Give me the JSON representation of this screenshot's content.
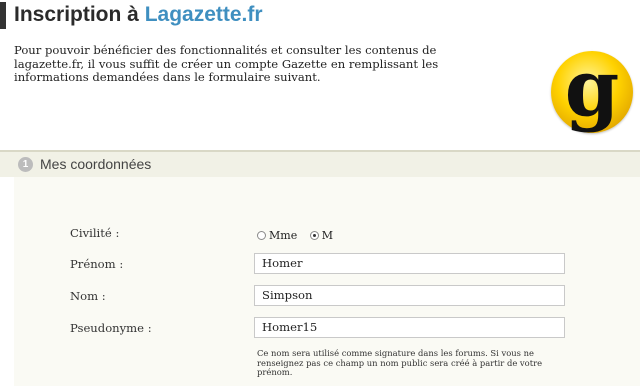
{
  "header": {
    "title_prefix": "Inscription à ",
    "title_brand": "Lagazette.fr"
  },
  "intro": {
    "text": "Pour pouvoir bénéficier des fonctionnalités et consulter les contenus de lagazette.fr, il vous suffit de créer un compte Gazette en remplissant les informations demandées dans le formulaire suivant."
  },
  "logo": {
    "letter": "g",
    "color": "#ffd200"
  },
  "section": {
    "number": "1",
    "title": "Mes coordonnées"
  },
  "form": {
    "civilite": {
      "label": "Civilité :",
      "options": [
        {
          "label": "Mme",
          "checked": false
        },
        {
          "label": "M",
          "checked": true
        }
      ]
    },
    "prenom": {
      "label": "Prénom :",
      "value": "Homer"
    },
    "nom": {
      "label": "Nom :",
      "value": "Simpson"
    },
    "pseudonyme": {
      "label": "Pseudonyme :",
      "value": "Homer15",
      "hint": "Ce nom sera utilisé comme signature dans les forums. Si vous ne renseignez pas ce champ un nom public sera créé à partir de votre prénom."
    }
  },
  "colors": {
    "brand": "#3f8fc0",
    "section_bg": "#f1f1e6"
  }
}
